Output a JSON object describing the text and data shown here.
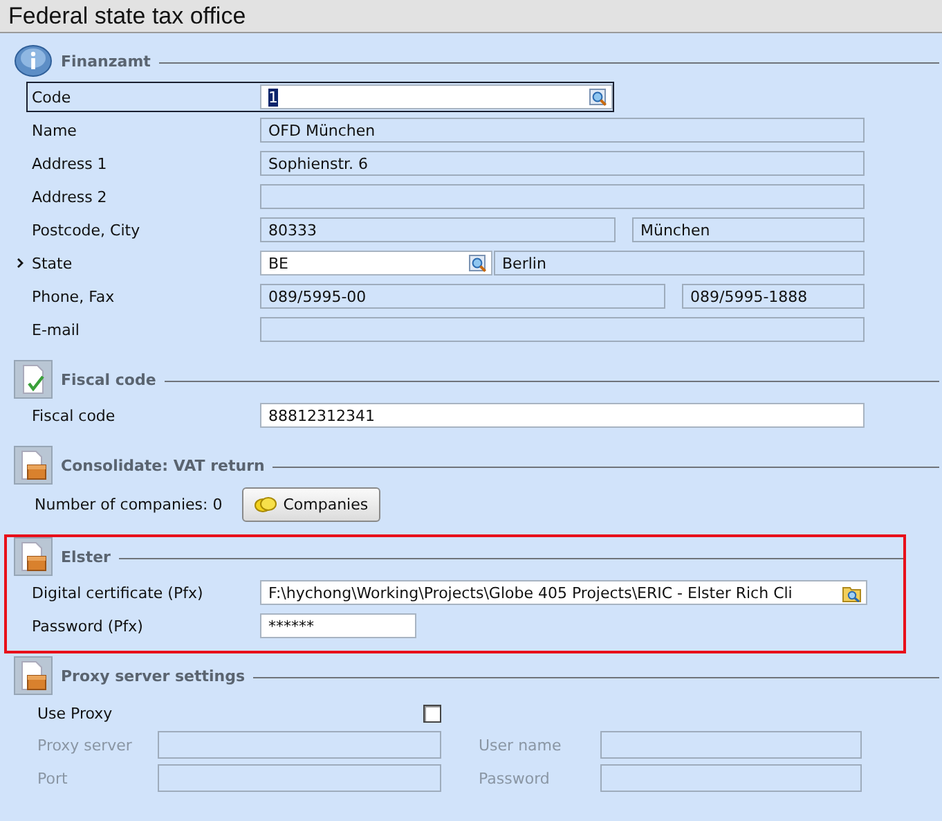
{
  "window": {
    "title": "Federal state tax office"
  },
  "sections": [
    {
      "kind": "form",
      "title": "Finanzamt",
      "highlighted": false,
      "rows": [
        {
          "kind": "lookup",
          "label": "Code",
          "focused": true,
          "current": false,
          "fields": [
            {
              "value": "1",
              "editable": true
            }
          ]
        },
        {
          "kind": "text",
          "label": "Name",
          "focused": false,
          "current": false,
          "fields": [
            {
              "value": "OFD München",
              "editable": false
            }
          ]
        },
        {
          "kind": "text",
          "label": "Address 1",
          "focused": false,
          "current": false,
          "fields": [
            {
              "value": "Sophienstr. 6",
              "editable": false
            }
          ]
        },
        {
          "kind": "text",
          "label": "Address 2",
          "focused": false,
          "current": false,
          "fields": [
            {
              "editable": false
            }
          ]
        },
        {
          "kind": "postcode",
          "label": "Postcode, City",
          "focused": false,
          "current": false,
          "fields": [
            {
              "value": "80333",
              "editable": false
            },
            {
              "value": "München",
              "editable": false
            }
          ]
        },
        {
          "kind": "lookuptext",
          "label": "State",
          "focused": false,
          "current": true,
          "fields": [
            {
              "value": "BE",
              "editable": true
            },
            {
              "value": "Berlin",
              "editable": false
            }
          ]
        },
        {
          "kind": "contact",
          "label": "Phone, Fax",
          "focused": false,
          "current": false,
          "fields": [
            {
              "value": "089/5995-00",
              "editable": false
            },
            {
              "value": "089/5995-1888",
              "editable": false
            }
          ]
        },
        {
          "kind": "text",
          "label": "E-mail",
          "focused": false,
          "current": false,
          "fields": [
            {
              "editable": false
            }
          ]
        }
      ]
    },
    {
      "kind": "form",
      "title": "Fiscal code",
      "highlighted": false,
      "rows": [
        {
          "kind": "text",
          "label": "Fiscal code",
          "focused": false,
          "current": false,
          "fields": [
            {
              "value": "88812312341",
              "editable": true
            }
          ]
        }
      ]
    },
    {
      "kind": "count",
      "title": "Consolidate: VAT return",
      "highlighted": false,
      "text": "Number of companies: 0",
      "button": "Companies"
    },
    {
      "kind": "form",
      "title": "Elster",
      "highlighted": true,
      "rows": [
        {
          "kind": "file",
          "label": "Digital certificate (Pfx)",
          "focused": false,
          "current": false,
          "fields": [
            {
              "value": "F:\\hychong\\Working\\Projects\\Globe 405 Projects\\ERIC - Elster Rich Cli",
              "editable": true
            }
          ]
        },
        {
          "kind": "short",
          "label": "Password (Pfx)",
          "focused": false,
          "current": false,
          "fields": [
            {
              "value": "******",
              "editable": true
            }
          ]
        }
      ]
    },
    {
      "kind": "proxy",
      "title": "Proxy server settings",
      "highlighted": false,
      "use_proxy": {
        "label": "Use Proxy",
        "checked": false
      },
      "disabled": true,
      "fields": [
        {
          "label": "Proxy server"
        },
        {
          "label": "User name"
        },
        {
          "label": "Port"
        },
        {
          "label": "Password"
        }
      ]
    }
  ]
}
